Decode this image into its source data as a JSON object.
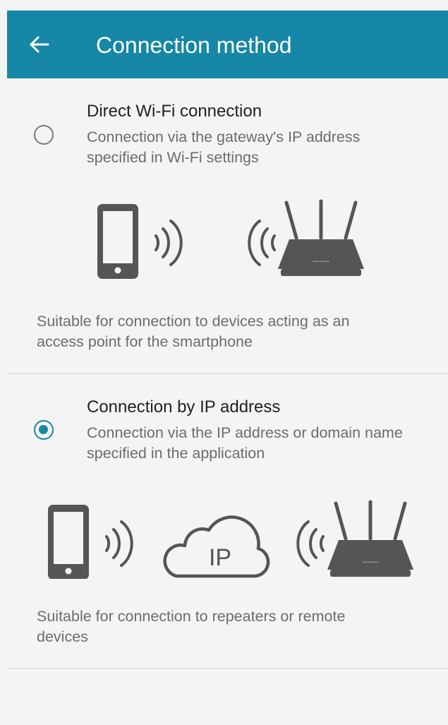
{
  "appbar": {
    "title": "Connection method",
    "back_icon": "arrow-left-icon",
    "color": "#1687a6"
  },
  "options": [
    {
      "title": "Direct Wi-Fi connection",
      "subtitle_lines": [
        "Connection via the gateway's IP address",
        "specified in Wi-Fi settings"
      ],
      "note_lines": [
        "Suitable for connection to devices acting as an",
        "access point for the smartphone"
      ],
      "selected": false,
      "icons": [
        "smartphone-icon",
        "wifi-waves-icon",
        "router-icon"
      ]
    },
    {
      "title": "Connection by IP address",
      "subtitle_lines": [
        "Connection via the IP address or domain name",
        "specified in the application"
      ],
      "note_lines": [
        "Suitable for connection to repeaters or remote",
        "devices"
      ],
      "selected": true,
      "cloud_label": "IP",
      "icons": [
        "smartphone-icon",
        "wifi-waves-icon",
        "cloud-ip-icon",
        "router-icon"
      ]
    }
  ],
  "colors": {
    "accent": "#1687a6",
    "icon": "#555555",
    "text_primary": "#222222",
    "text_secondary": "#6c6c6c"
  }
}
